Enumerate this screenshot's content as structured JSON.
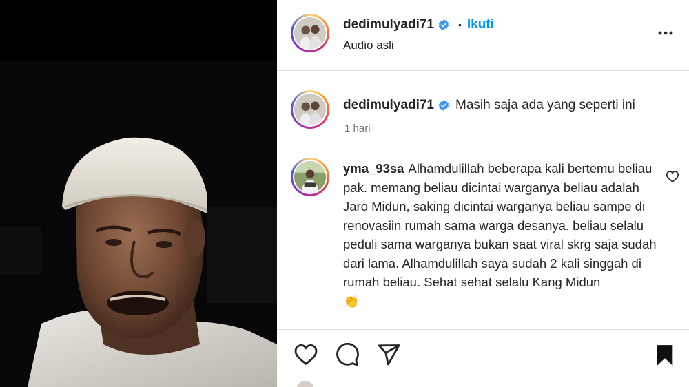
{
  "post_header": {
    "username": "dedimulyadi71",
    "follow_label": "Ikuti",
    "audio_label": "Audio asli"
  },
  "caption": {
    "username": "dedimulyadi71",
    "text": "Masih saja ada yang seperti ini",
    "time": "1 hari"
  },
  "comments": [
    {
      "username": "yma_93sa",
      "text": "Alhamdulillah beberapa kali bertemu beliau pak. memang beliau dicintai warganya beliau adalah Jaro Midun, saking dicintai warganya beliau sampe di renovasiin rumah sama warga desanya. beliau selalu peduli sama warganya bukan saat viral skrg saja sudah dari lama. Alhamdulillah saya sudah 2 kali singgah di rumah beliau. Sehat sehat selalu Kang Midun",
      "emoji": "👏"
    }
  ],
  "colors": {
    "accent_blue": "#0095f6",
    "verified_blue": "#3897f0",
    "text": "#262626",
    "muted": "#737373",
    "divider": "#dbdbdb"
  },
  "icons": {
    "header_more": "more-horizontal-icon",
    "verified": "verified-badge-icon",
    "comment_like": "heart-outline-icon",
    "like": "heart-icon",
    "comment": "comment-bubble-icon",
    "share": "paper-plane-icon",
    "save": "bookmark-filled-icon"
  }
}
